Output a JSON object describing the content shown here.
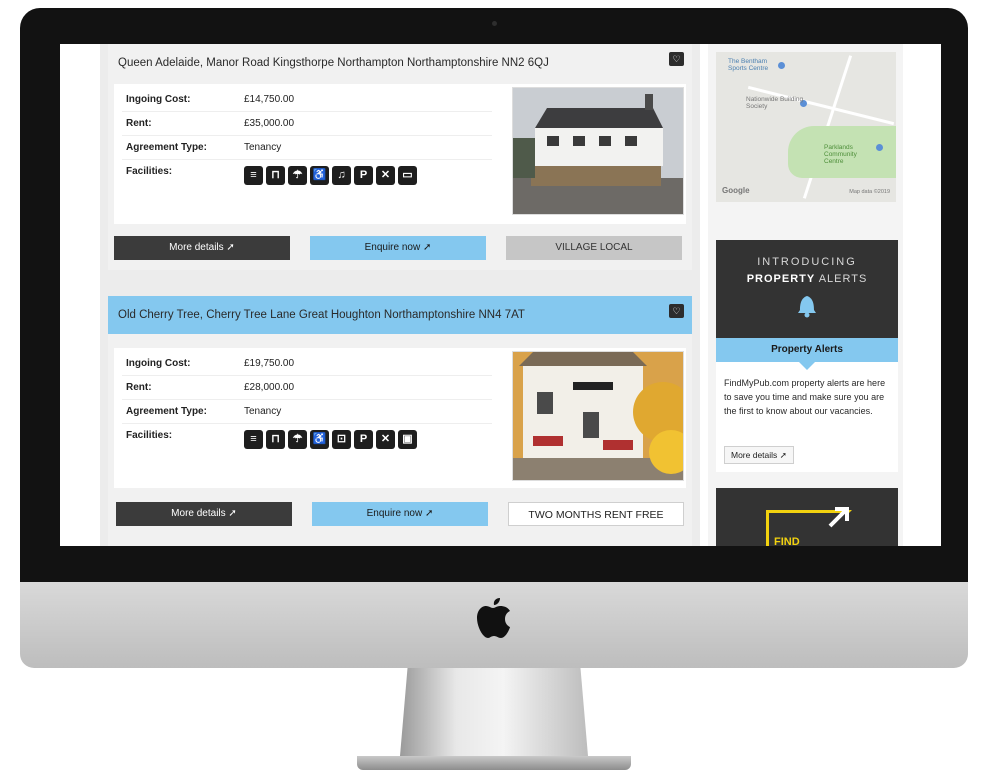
{
  "listings": [
    {
      "address": "Queen Adelaide, Manor Road Kingsthorpe Northampton Northamptonshire NN2 6QJ",
      "highlighted": false,
      "ingoing_label": "Ingoing Cost:",
      "ingoing_value": "£14,750.00",
      "rent_label": "Rent:",
      "rent_value": "£35,000.00",
      "agreement_label": "Agreement Type:",
      "agreement_value": "Tenancy",
      "facilities_label": "Facilities:",
      "facilities": [
        "bar-icon",
        "picnic-table-icon",
        "parasol-icon",
        "wheelchair-icon",
        "music-icon",
        "parking-icon",
        "cutlery-icon",
        "tv-icon"
      ],
      "more_details": "More details",
      "enquire": "Enquire now",
      "tag": "VILLAGE LOCAL"
    },
    {
      "address": "Old Cherry Tree, Cherry Tree Lane Great Houghton Northamptonshire NN4 7AT",
      "highlighted": true,
      "ingoing_label": "Ingoing Cost:",
      "ingoing_value": "£19,750.00",
      "rent_label": "Rent:",
      "rent_value": "£28,000.00",
      "agreement_label": "Agreement Type:",
      "agreement_value": "Tenancy",
      "facilities_label": "Facilities:",
      "facilities": [
        "bar-icon",
        "picnic-table-icon",
        "parasol-icon",
        "wheelchair-icon",
        "car-icon",
        "parking-icon",
        "cutlery-icon",
        "briefcase-icon"
      ],
      "more_details": "More details",
      "enquire": "Enquire now",
      "tag": "TWO MONTHS RENT FREE"
    }
  ],
  "map": {
    "label_bentham": "The Bentham Sports Centre",
    "label_nationwide": "Nationwide Building Society",
    "label_parklands": "Parklands Community Centre",
    "google": "Google",
    "map_data": "Map data ©2019"
  },
  "alerts": {
    "introducing": "INTRODUCING",
    "property_bold": "PROPERTY",
    "alerts_word": "ALERTS",
    "title": "Property Alerts",
    "text": "FindMyPub.com property alerts are here to save you time and make sure you are the first to know about our vacancies.",
    "button": "More details"
  },
  "find_banner": {
    "text": "FIND"
  },
  "colors": {
    "accent_blue": "#84c8ef",
    "dark": "#3b3b3b",
    "find_yellow": "#f2d20f"
  }
}
